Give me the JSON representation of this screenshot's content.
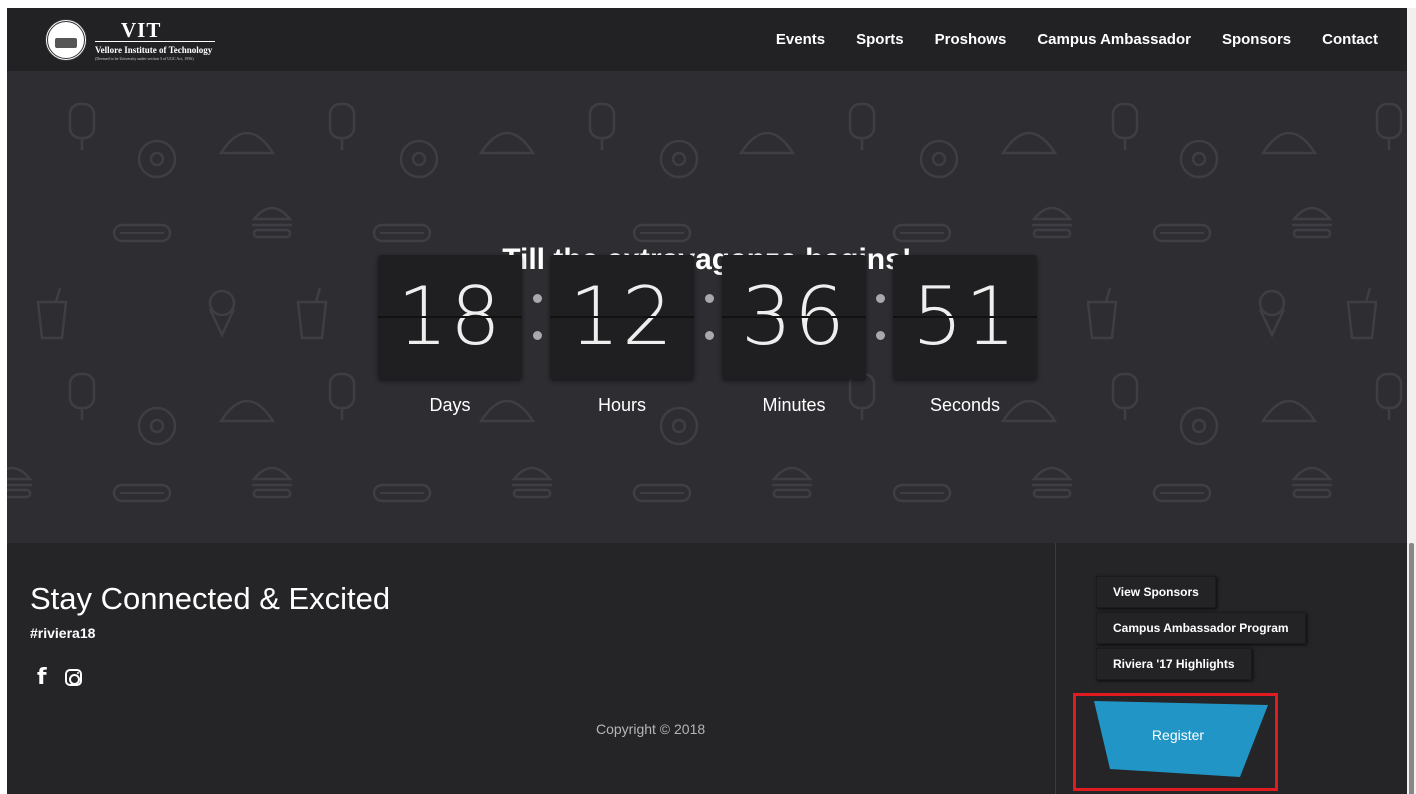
{
  "nav": {
    "logo_title": "VIT",
    "logo_subtitle": "Vellore Institute of Technology",
    "logo_tagline": "(Deemed to be University under section 3 of UGC Act, 1956)",
    "links": [
      "Events",
      "Sports",
      "Proshows",
      "Campus Ambassador",
      "Sponsors",
      "Contact"
    ]
  },
  "hero": {
    "title": "Till the extravaganza begins!",
    "countdown": {
      "days": "18",
      "hours": "12",
      "minutes": "36",
      "seconds": "51",
      "labels": [
        "Days",
        "Hours",
        "Minutes",
        "Seconds"
      ]
    }
  },
  "footer": {
    "title": "Stay Connected & Excited",
    "hashtag": "#riviera18",
    "social_icons": [
      "facebook-icon",
      "instagram-icon"
    ],
    "copyright": "Copyright © 2018",
    "quick_links": [
      "View Sponsors",
      "Campus Ambassador Program",
      "Riviera '17 Highlights"
    ],
    "register_label": "Register"
  },
  "colors": {
    "nav_bg": "#222124",
    "hero_bg": "#2e2d32",
    "footer_bg": "#252426",
    "register_blue": "#2196c6",
    "highlight_red": "#e01b22"
  }
}
